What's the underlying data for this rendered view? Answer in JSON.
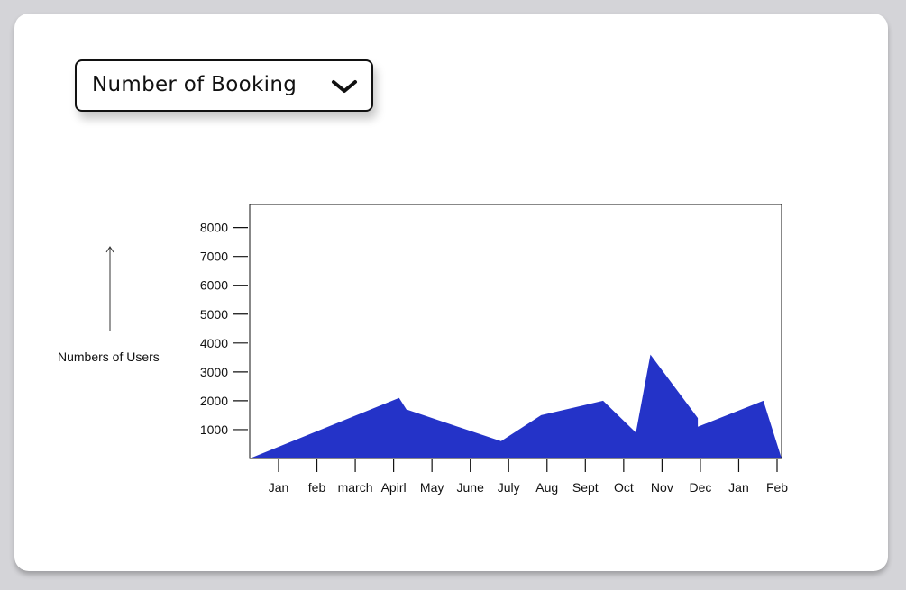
{
  "dropdown": {
    "selected": "Number of Booking",
    "icon": "chevron-down-icon"
  },
  "chart_data": {
    "type": "area",
    "title": "",
    "xlabel": "",
    "ylabel": "Numbers of Users",
    "categories": [
      "Jan",
      "feb",
      "march",
      "Apirl",
      "May",
      "June",
      "July",
      "Aug",
      "Sept",
      "Oct",
      "Nov",
      "Dec",
      "Jan",
      "Feb"
    ],
    "yticks": [
      1000,
      2000,
      3000,
      4000,
      5000,
      6000,
      7000,
      8000
    ],
    "ylim": [
      0,
      8800
    ],
    "xlim": [
      0,
      14.6
    ],
    "grid": false,
    "legend": "none",
    "series": [
      {
        "color": "#2433c8",
        "points": [
          {
            "x": 0,
            "y": 0
          },
          {
            "x": 4.1,
            "y": 2100
          },
          {
            "x": 4.3,
            "y": 1700
          },
          {
            "x": 6.9,
            "y": 600
          },
          {
            "x": 8.0,
            "y": 1500
          },
          {
            "x": 9.7,
            "y": 2000
          },
          {
            "x": 10.6,
            "y": 900
          },
          {
            "x": 11.0,
            "y": 3600
          },
          {
            "x": 12.3,
            "y": 1400
          },
          {
            "x": 12.3,
            "y": 1100
          },
          {
            "x": 14.1,
            "y": 2000
          },
          {
            "x": 14.6,
            "y": 0
          }
        ]
      }
    ]
  }
}
